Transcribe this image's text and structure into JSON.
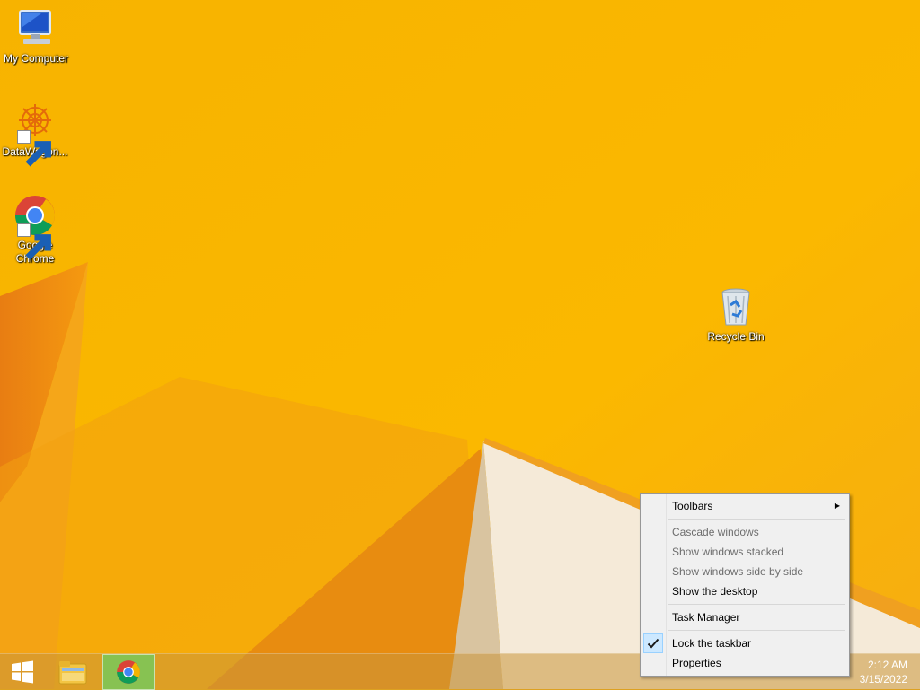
{
  "desktop": {
    "icons": [
      {
        "label": "My Computer",
        "icon": "computer-icon"
      },
      {
        "label": "DataWagon...",
        "icon": "datawagon-icon"
      },
      {
        "label": "Google\nChrome",
        "label_line1": "Google",
        "label_line2": "Chrome",
        "icon": "chrome-icon"
      },
      {
        "label": "Recycle Bin",
        "icon": "recycle-bin-icon"
      }
    ]
  },
  "taskbar": {
    "start_icon": "windows-logo-icon",
    "pinned": [
      {
        "name": "File Explorer",
        "icon": "folder-icon"
      },
      {
        "name": "Google Chrome",
        "icon": "chrome-icon",
        "active": true
      }
    ],
    "clock": {
      "time": "2:12 AM",
      "date": "3/15/2022"
    }
  },
  "context_menu": {
    "items": [
      {
        "label": "Toolbars",
        "enabled": true,
        "submenu": true
      },
      {
        "label": "Cascade windows",
        "enabled": false
      },
      {
        "label": "Show windows stacked",
        "enabled": false
      },
      {
        "label": "Show windows side by side",
        "enabled": false
      },
      {
        "label": "Show the desktop",
        "enabled": true
      },
      {
        "label": "Task Manager",
        "enabled": true
      },
      {
        "label": "Lock the taskbar",
        "enabled": true,
        "checked": true
      },
      {
        "label": "Properties",
        "enabled": true
      }
    ]
  },
  "colors": {
    "wallpaper": "#f7b000",
    "menu_bg": "#f0f0f0",
    "check_bg": "#cce8ff",
    "active_taskbar_button": "#78c85a"
  }
}
